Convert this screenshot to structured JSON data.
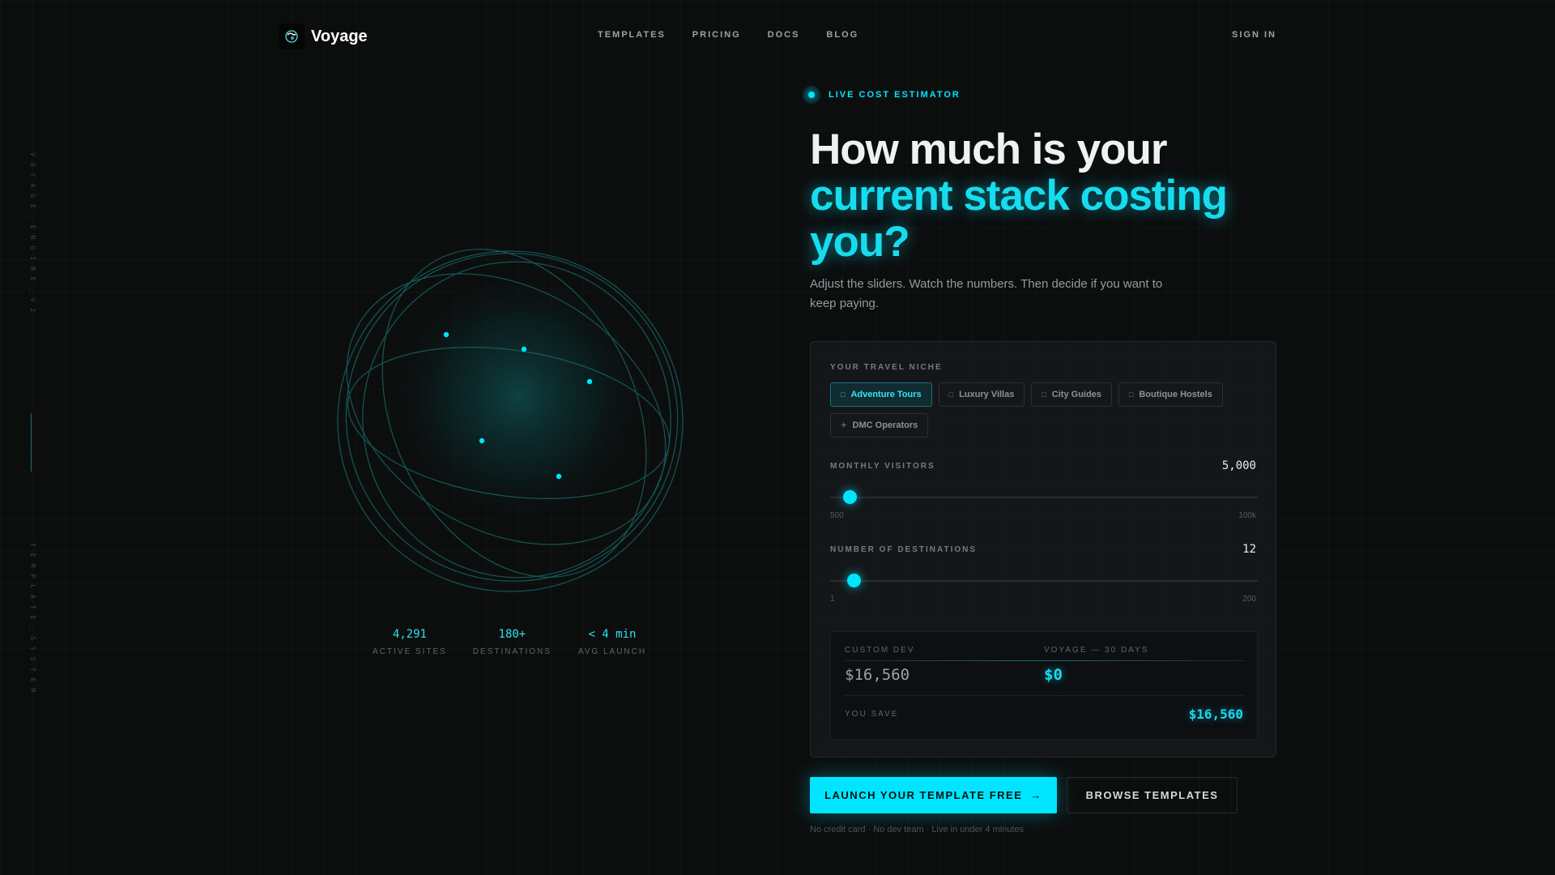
{
  "brand": {
    "name": "Voyage"
  },
  "nav": {
    "links": [
      "TEMPLATES",
      "PRICING",
      "DOCS",
      "BLOG"
    ],
    "sign_in": "SIGN IN"
  },
  "side_labels": {
    "top": "VOYAGE_ENGINE_V2",
    "bottom": "TEMPLATE_SYSTEM"
  },
  "stats": [
    {
      "value": "4,291",
      "label": "ACTIVE SITES"
    },
    {
      "value": "180+",
      "label": "DESTINATIONS"
    },
    {
      "value": "< 4 min",
      "label": "AVG LAUNCH"
    }
  ],
  "hero": {
    "badge": "LIVE COST ESTIMATOR",
    "title_line1": "How much is your",
    "title_line2": "current stack costing",
    "title_line3": "you?",
    "subtitle": "Adjust the sliders. Watch the numbers. Then decide if you want to keep paying."
  },
  "estimator": {
    "niche_label": "YOUR TRAVEL NICHE",
    "niches": [
      {
        "label": "Adventure Tours",
        "icon": "□",
        "active": true
      },
      {
        "label": "Luxury Villas",
        "icon": "□",
        "active": false
      },
      {
        "label": "City Guides",
        "icon": "□",
        "active": false
      },
      {
        "label": "Boutique Hostels",
        "icon": "□",
        "active": false
      },
      {
        "label": "DMC Operators",
        "icon": "✈",
        "active": false
      }
    ],
    "visitors": {
      "label": "MONTHLY VISITORS",
      "value": "5,000",
      "min": "500",
      "max": "100k",
      "fraction": 0.045
    },
    "destinations": {
      "label": "NUMBER OF DESTINATIONS",
      "value": "12",
      "min": "1",
      "max": "200",
      "fraction": 0.055
    },
    "results": {
      "custom_label": "CUSTOM DEV",
      "custom_value": "$16,560",
      "voyage_label": "VOYAGE — 30 DAYS",
      "voyage_value": "$0",
      "save_label": "YOU SAVE",
      "save_value": "$16,560"
    }
  },
  "cta": {
    "primary": "LAUNCH YOUR TEMPLATE FREE",
    "primary_icon": "→",
    "secondary": "BROWSE TEMPLATES",
    "fineprint": "No credit card · No dev team · Live in under 4 minutes"
  },
  "colors": {
    "accent": "#00e5ff",
    "background": "#0c0e0e"
  }
}
